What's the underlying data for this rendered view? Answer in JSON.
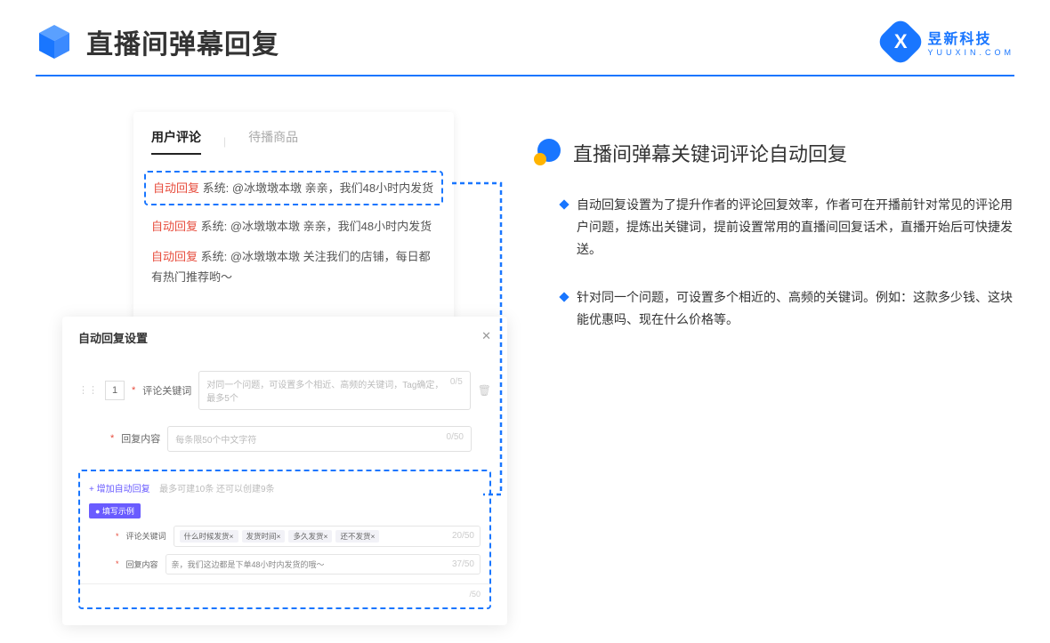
{
  "header": {
    "title": "直播间弹幕回复",
    "logo_cn": "昱新科技",
    "logo_en": "YUUXIN.COM"
  },
  "comment_panel": {
    "tab_active": "用户评论",
    "tab_inactive": "待播商品",
    "items": [
      {
        "tag": "自动回复",
        "text": "系统: @冰墩墩本墩 亲亲，我们48小时内发货"
      },
      {
        "tag": "自动回复",
        "text": "系统: @冰墩墩本墩 亲亲，我们48小时内发货"
      },
      {
        "tag": "自动回复",
        "text": "系统: @冰墩墩本墩 关注我们的店铺，每日都有热门推荐哟～"
      }
    ]
  },
  "settings": {
    "title": "自动回复设置",
    "row_num": "1",
    "keyword_label": "评论关键词",
    "keyword_placeholder": "对同一个问题，可设置多个相近、高频的关键词，Tag确定，最多5个",
    "keyword_count": "0/5",
    "content_label": "回复内容",
    "content_placeholder": "每条限50个中文字符",
    "content_count": "0/50",
    "add_link": "+ 增加自动回复",
    "add_hint": "最多可建10条 还可以创建9条",
    "example_badge": "● 填写示例",
    "ex_keyword_label": "评论关键词",
    "ex_tags": [
      "什么时候发货×",
      "发货时间×",
      "多久发货×",
      "还不发货×"
    ],
    "ex_keyword_count": "20/50",
    "ex_content_label": "回复内容",
    "ex_content_text": "亲，我们这边都是下单48小时内发货的哦～",
    "ex_content_count": "37/50",
    "bottom_count": "/50"
  },
  "right": {
    "section_title": "直播间弹幕关键词评论自动回复",
    "bullets": [
      "自动回复设置为了提升作者的评论回复效率，作者可在开播前针对常见的评论用户问题，提炼出关键词，提前设置常用的直播间回复话术，直播开始后可快捷发送。",
      "针对同一个问题，可设置多个相近的、高频的关键词。例如：这款多少钱、这块能优惠吗、现在什么价格等。"
    ]
  }
}
